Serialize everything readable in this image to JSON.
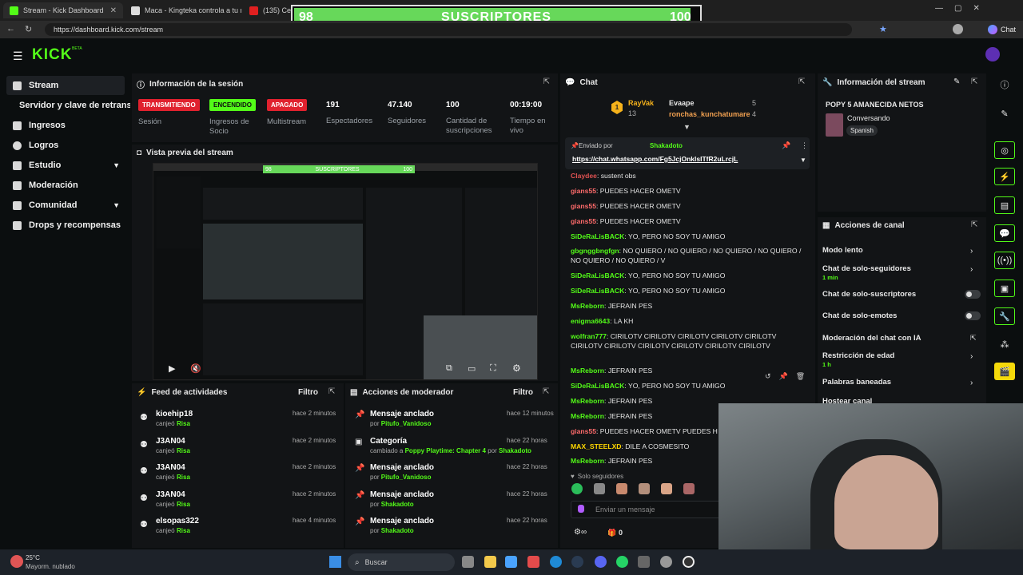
{
  "browser": {
    "tabs": [
      {
        "label": "Stream - Kick Dashboard"
      },
      {
        "label": "Maca - Kingteka controla a tu mu"
      },
      {
        "label": "(135) Cevich"
      }
    ],
    "url": "https://dashboard.kick.com/stream",
    "copilot_label": "Chat"
  },
  "overlay": {
    "left_number": "98",
    "title": "SUSCRIPTORES",
    "right_number": "100"
  },
  "header": {
    "logo": "KICK",
    "beta": "BETA"
  },
  "sidebar": {
    "items": [
      {
        "label": "Stream"
      },
      {
        "label": "Servidor y clave de retransm"
      },
      {
        "label": "Ingresos"
      },
      {
        "label": "Logros"
      },
      {
        "label": "Estudio"
      },
      {
        "label": "Moderación"
      },
      {
        "label": "Comunidad"
      },
      {
        "label": "Drops y recompensas"
      }
    ]
  },
  "session": {
    "title": "Información de la sesión",
    "stats": [
      {
        "badge": "TRANSMITIENDO",
        "label": "Sesión"
      },
      {
        "badge": "ENCENDIDO",
        "label": "Ingresos de Socio"
      },
      {
        "badge": "APAGADO",
        "label": "Multistream"
      },
      {
        "value": "191",
        "label": "Espectadores"
      },
      {
        "value": "47.140",
        "label": "Seguidores"
      },
      {
        "value": "100",
        "label": "Cantidad de suscripciones"
      },
      {
        "value": "00:19:00",
        "label": "Tiempo en vivo"
      }
    ]
  },
  "preview": {
    "title": "Vista previa del stream",
    "inner_banner_left": "98",
    "inner_banner": "SUSCRIPTORES",
    "inner_banner_right": "100"
  },
  "feed": {
    "title": "Feed de actividades",
    "filter": "Filtro",
    "rows": [
      {
        "user": "kioehip18",
        "action": "canjeó",
        "reward": "Risa",
        "time": "hace 2 minutos"
      },
      {
        "user": "J3AN04",
        "action": "canjeó",
        "reward": "Risa",
        "time": "hace 2 minutos"
      },
      {
        "user": "J3AN04",
        "action": "canjeó",
        "reward": "Risa",
        "time": "hace 2 minutos"
      },
      {
        "user": "J3AN04",
        "action": "canjeó",
        "reward": "Risa",
        "time": "hace 2 minutos"
      },
      {
        "user": "elsopas322",
        "action": "canjeó",
        "reward": "Risa",
        "time": "hace 4 minutos"
      }
    ]
  },
  "modactions": {
    "title": "Acciones de moderador",
    "filter": "Filtro",
    "rows": [
      {
        "title": "Mensaje anclado",
        "pre": "por",
        "who": "Pitufo_Vanidoso",
        "mid": "",
        "post": "",
        "time": "hace 12 minutos"
      },
      {
        "title": "Categoría",
        "pre": "cambiado a",
        "who": "Poppy Playtime: Chapter 4",
        "mid": "por",
        "post": "Shakadoto",
        "time": "hace 22 horas"
      },
      {
        "title": "Mensaje anclado",
        "pre": "por",
        "who": "Pitufo_Vanidoso",
        "mid": "",
        "post": "",
        "time": "hace 22 horas"
      },
      {
        "title": "Mensaje anclado",
        "pre": "por",
        "who": "Shakadoto",
        "mid": "",
        "post": "",
        "time": "hace 22 horas"
      },
      {
        "title": "Mensaje anclado",
        "pre": "por",
        "who": "Shakadoto",
        "mid": "",
        "post": "",
        "time": "hace 22 horas"
      }
    ]
  },
  "chat": {
    "title": "Chat",
    "gifters": {
      "rank": "1",
      "user1": "RayVak",
      "count1": "13",
      "user2": "Evaape",
      "count2": "5",
      "user3": "ronchas_kunchatumare",
      "count3": "4"
    },
    "pinned": {
      "label": "Enviado por",
      "by": "Shakadoto",
      "link": "https://chat.whatsapp.com/Fg5JcjOnklsITfR2uLrcjL"
    },
    "messages": [
      {
        "user": "Claydee",
        "color": "#e05252",
        "text": "sustent obs"
      },
      {
        "user": "gians55",
        "color": "#ff6b6b",
        "text": "PUEDES HACER OMETV"
      },
      {
        "user": "gians55",
        "color": "#ff6b6b",
        "text": "PUEDES HACER OMETV"
      },
      {
        "user": "gians55",
        "color": "#ff6b6b",
        "text": "PUEDES HACER OMETV"
      },
      {
        "user": "SiDeRaLisBACK",
        "color": "#53fc18",
        "text": "YO, PERO NO SOY TU AMIGO"
      },
      {
        "user": "gbgnggbngfgn",
        "color": "#53fc18",
        "text": "NO QUIERO / NO QUIERO / NO QUIERO / NO QUIERO / NO QUIERO / NO QUIERO / V"
      },
      {
        "user": "SiDeRaLisBACK",
        "color": "#53fc18",
        "text": "YO, PERO NO SOY TU AMIGO"
      },
      {
        "user": "SiDeRaLisBACK",
        "color": "#53fc18",
        "text": "YO, PERO NO SOY TU AMIGO"
      },
      {
        "user": "MsReborn",
        "color": "#53fc18",
        "text": "JEFRAIN PES"
      },
      {
        "user": "enigma6643",
        "color": "#53fc18",
        "text": "LA KH"
      },
      {
        "user": "wolfran777",
        "color": "#53fc18",
        "text": "CIRILOTV CIRILOTV CIRILOTV CIRILOTV CIRILOTV CIRILOTV CIRILOTV CIRILOTV CIRILOTV CIRILOTV CIRILOTV"
      },
      {
        "user": "MsReborn",
        "color": "#53fc18",
        "text": "JEFRAIN PES"
      },
      {
        "user": "SiDeRaLisBACK",
        "color": "#53fc18",
        "text": "YO, PERO NO SOY TU AMIGO"
      },
      {
        "user": "MsReborn",
        "color": "#53fc18",
        "text": "JEFRAIN PES"
      },
      {
        "user": "MsReborn",
        "color": "#53fc18",
        "text": "JEFRAIN PES"
      },
      {
        "user": "gians55",
        "color": "#ff6b6b",
        "text": "PUEDES HACER OMETV PUEDES H"
      },
      {
        "user": "MAX_STEELXD",
        "color": "#ffd700",
        "text": "DILE A COSMESITO"
      },
      {
        "user": "MsReborn",
        "color": "#53fc18",
        "text": "JEFRAIN PES"
      }
    ],
    "followers_only": "Solo seguidores",
    "input_placeholder": "Enviar un mensaje",
    "points": "0"
  },
  "streaminfo": {
    "title": "Información del stream",
    "stream_title": "POPY 5 AMANECIDA NETOS",
    "category": "Conversando",
    "language": "Spanish"
  },
  "channel": {
    "title": "Acciones de canal",
    "items": [
      {
        "label": "Modo lento",
        "sub": ""
      },
      {
        "label": "Chat de solo-seguidores",
        "sub": "1 min"
      },
      {
        "label": "Chat de solo-suscriptores",
        "sub": ""
      },
      {
        "label": "Chat de solo-emotes",
        "sub": ""
      },
      {
        "label": "Moderación del chat con IA",
        "sub": ""
      },
      {
        "label": "Restricción de edad",
        "sub": "1 h"
      },
      {
        "label": "Palabras baneadas",
        "sub": ""
      },
      {
        "label": "Hostear canal",
        "sub": ""
      }
    ]
  },
  "taskbar": {
    "temp": "25°C",
    "weather": "Mayorm. nublado",
    "search": "Buscar"
  },
  "colors": {
    "kick_green": "#53fc18",
    "live_red": "#e0212e",
    "panel": "#121416"
  }
}
